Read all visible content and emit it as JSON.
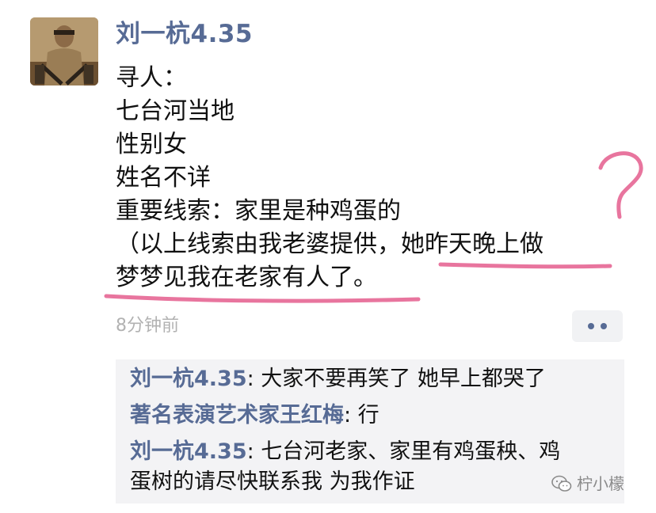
{
  "post": {
    "author": "刘一杭4.35",
    "lines": [
      "寻人：",
      "七台河当地",
      "性别女",
      "姓名不详",
      "重要线索：家里是种鸡蛋的",
      "（以上线索由我老婆提供，她昨天晚上做",
      "梦梦见我在老家有人了。"
    ],
    "time": "8分钟前",
    "more_icon": "more-dots-icon"
  },
  "comments": [
    {
      "name": "刘一杭4.35",
      "text": ": 大家不要再笑了 她早上都哭了"
    },
    {
      "name": "著名表演艺术家王红梅",
      "text": ": 行"
    },
    {
      "name": "刘一杭4.35",
      "text": ": 七台河老家、家里有鸡蛋秧、鸡"
    },
    {
      "name": "",
      "text": "蛋树的请尽快联系我 为我作证"
    }
  ],
  "watermark": {
    "icon": "wechat-icon",
    "text": "柠小檬"
  },
  "annotation_color": "#e8759e"
}
